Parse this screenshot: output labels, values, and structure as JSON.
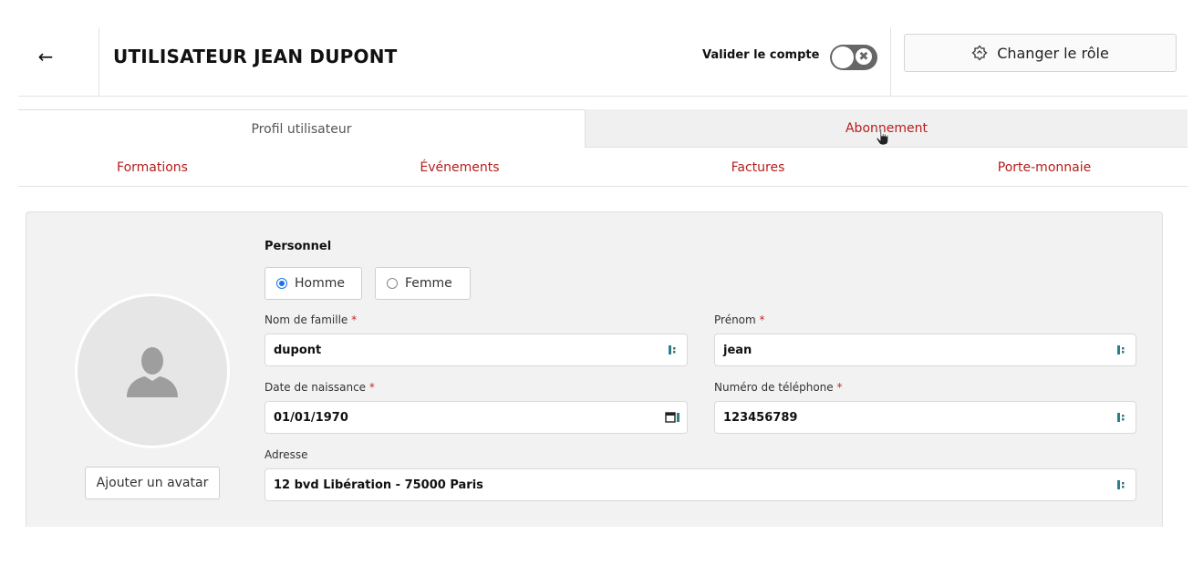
{
  "header": {
    "back_icon": "←",
    "title": "UTILISATEUR JEAN DUPONT",
    "validate_label": "Valider le compte",
    "toggle_icon": "✖",
    "role_button_label": "Changer le rôle"
  },
  "tabs": {
    "profil": "Profil utilisateur",
    "abonnement": "Abonnement"
  },
  "subtabs": [
    "Formations",
    "Événements",
    "Factures",
    "Porte-monnaie"
  ],
  "profile": {
    "add_avatar_label": "Ajouter un avatar",
    "section_title": "Personnel",
    "gender": {
      "homme": "Homme",
      "femme": "Femme",
      "selected": "Homme"
    },
    "fields": {
      "nom_label": "Nom de famille",
      "nom_value": "dupont",
      "prenom_label": "Prénom",
      "prenom_value": "jean",
      "naissance_label": "Date de naissance",
      "naissance_value": "01/01/1970",
      "telephone_label": "Numéro de téléphone",
      "telephone_value": "123456789",
      "adresse_label": "Adresse",
      "adresse_value": "12 bvd Libération - 75000 Paris",
      "required_mark": "*"
    }
  },
  "colors": {
    "accent_red": "#b71c1c",
    "required_red": "#c62828",
    "toggle_gray": "#666666",
    "field_icon_teal": "#2e7d8a",
    "radio_blue": "#1a73e8"
  }
}
